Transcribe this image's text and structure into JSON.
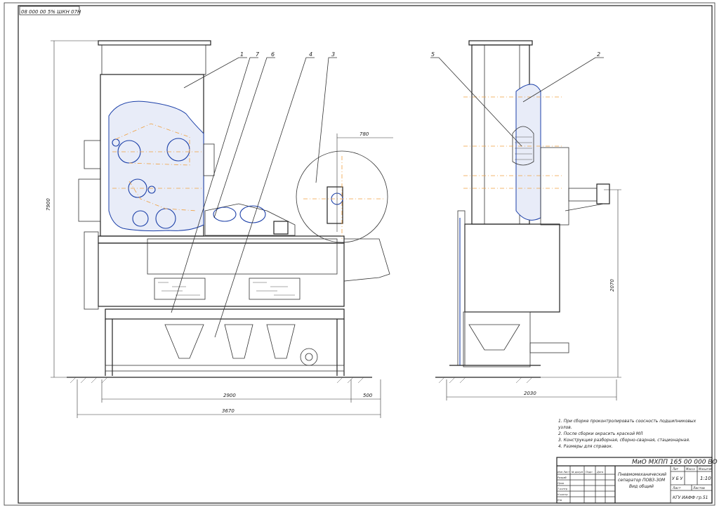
{
  "drawing_code_rotated": "08 000 00 5% ШКН 07Н",
  "callouts": {
    "front": [
      "1",
      "7",
      "6",
      "4",
      "3"
    ],
    "side": [
      "5",
      "2"
    ]
  },
  "dimensions": {
    "height_front": "7900",
    "width_2900": "2900",
    "width_500": "500",
    "width_3670": "3670",
    "detail_780": "780",
    "height_side": "2070",
    "width_side": "2030"
  },
  "notes": [
    "1. При сборке проконтролировать соосность подшипниковых",
    "узлов.",
    "2. После сборки окрасить краской МЛ",
    "3. Конструкция разборная, сборно-сварная, стационарная.",
    "4. Размеры для справок."
  ],
  "title_block": {
    "designation": "МиО МХПП 165 00 000 ВО",
    "name_line1": "Пневмомеханический",
    "name_line2": "сепаратор ПОВЗ-30М",
    "name_line3": "Вид общий",
    "hdr_lit": "Лит",
    "hdr_mass": "Масса",
    "hdr_scale": "Масштаб",
    "lit_value": "У Б У",
    "scale_value": "1:10",
    "sheet_label": "Лист",
    "sheets_label": "Листов",
    "org": "КГУ ИАФФ гр.51",
    "rows": [
      "Изм Лист",
      "Разраб",
      "Пров",
      "Т.контр",
      "Н.контр",
      "Утв"
    ],
    "cols": [
      "№ докум",
      "Подп",
      "Дата"
    ]
  }
}
